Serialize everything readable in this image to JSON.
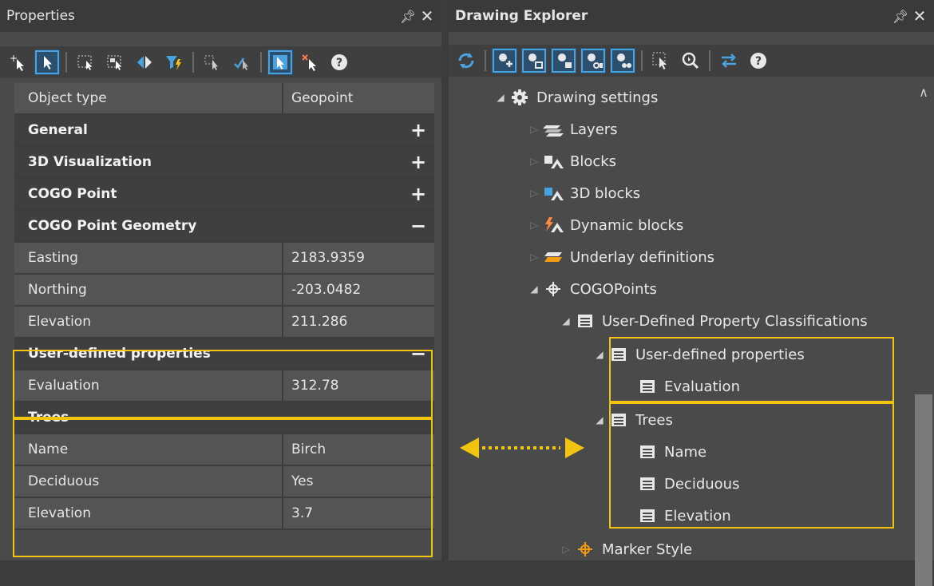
{
  "left_panel": {
    "title": "Properties",
    "pin": "⬚",
    "close": "✕",
    "header_row": {
      "key": "Object type",
      "value": "Geopoint"
    },
    "categories": {
      "general": {
        "label": "General",
        "sign": "+"
      },
      "viz3d": {
        "label": "3D Visualization",
        "sign": "+"
      },
      "cogo": {
        "label": "COGO Point",
        "sign": "+"
      },
      "geometry": {
        "label": "COGO Point Geometry",
        "sign": "−"
      },
      "udp": {
        "label": "User-defined properties",
        "sign": "−"
      },
      "trees": {
        "label": "Trees",
        "sign": "−"
      }
    },
    "geometry_props": [
      {
        "key": "Easting",
        "value": "2183.9359"
      },
      {
        "key": "Northing",
        "value": "-203.0482"
      },
      {
        "key": "Elevation",
        "value": "211.286"
      }
    ],
    "udp_props": [
      {
        "key": "Evaluation",
        "value": "312.78"
      }
    ],
    "tree_props": [
      {
        "key": "Name",
        "value": "Birch"
      },
      {
        "key": "Deciduous",
        "value": "Yes"
      },
      {
        "key": "Elevation",
        "value": "3.7"
      }
    ]
  },
  "right_panel": {
    "title": "Drawing Explorer",
    "pin": "⬚",
    "close": "✕",
    "tree": {
      "drawing_settings": "Drawing settings",
      "layers": "Layers",
      "blocks": "Blocks",
      "blocks3d": "3D blocks",
      "dynamic_blocks": "Dynamic blocks",
      "underlay": "Underlay definitions",
      "cogopoints": "COGOPoints",
      "udp_class": "User-Defined Property Classifications",
      "udp": "User-defined properties",
      "evaluation": "Evaluation",
      "trees": "Trees",
      "name": "Name",
      "deciduous": "Deciduous",
      "elevation": "Elevation",
      "marker_style": "Marker Style"
    }
  },
  "colors": {
    "highlight": "#f1c40f",
    "accent_blue": "#4aa3df"
  }
}
